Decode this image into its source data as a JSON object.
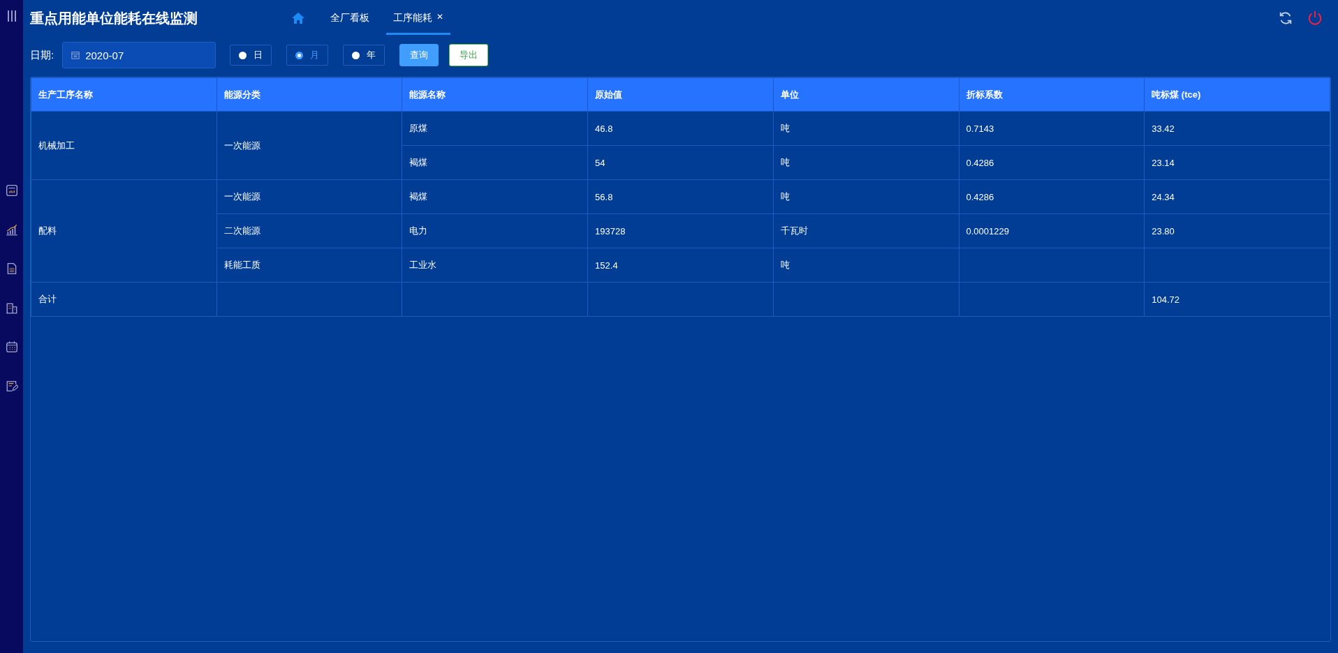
{
  "header": {
    "title": "重点用能单位能耗在线监测",
    "tabs": [
      {
        "label": "全厂看板",
        "selected": false,
        "closable": false
      },
      {
        "label": "工序能耗",
        "selected": true,
        "closable": true
      }
    ],
    "close_mark": "✕"
  },
  "filter": {
    "date_label": "日期:",
    "date_value": "2020-07",
    "periods": [
      {
        "label": "日",
        "selected": false
      },
      {
        "label": "月",
        "selected": true
      },
      {
        "label": "年",
        "selected": false
      }
    ],
    "query_button": "查询",
    "export_button": "导出"
  },
  "table": {
    "columns": [
      "生产工序名称",
      "能源分类",
      "能源名称",
      "原始值",
      "单位",
      "折标系数",
      "吨标煤 (tce)"
    ],
    "groups": [
      {
        "process": "机械加工",
        "categories": [
          {
            "category": "一次能源",
            "items": [
              {
                "name": "原煤",
                "raw": "46.8",
                "unit": "吨",
                "factor": "0.7143",
                "tce": "33.42"
              },
              {
                "name": "褐煤",
                "raw": "54",
                "unit": "吨",
                "factor": "0.4286",
                "tce": "23.14"
              }
            ]
          }
        ]
      },
      {
        "process": "配料",
        "categories": [
          {
            "category": "一次能源",
            "items": [
              {
                "name": "褐煤",
                "raw": "56.8",
                "unit": "吨",
                "factor": "0.4286",
                "tce": "24.34"
              }
            ]
          },
          {
            "category": "二次能源",
            "items": [
              {
                "name": "电力",
                "raw": "193728",
                "unit": "千瓦时",
                "factor": "0.0001229",
                "tce": "23.80"
              }
            ]
          },
          {
            "category": "耗能工质",
            "items": [
              {
                "name": "工业水",
                "raw": "152.4",
                "unit": "吨"
              }
            ]
          }
        ]
      }
    ],
    "total": {
      "label": "合计",
      "tce": "104.72"
    }
  }
}
